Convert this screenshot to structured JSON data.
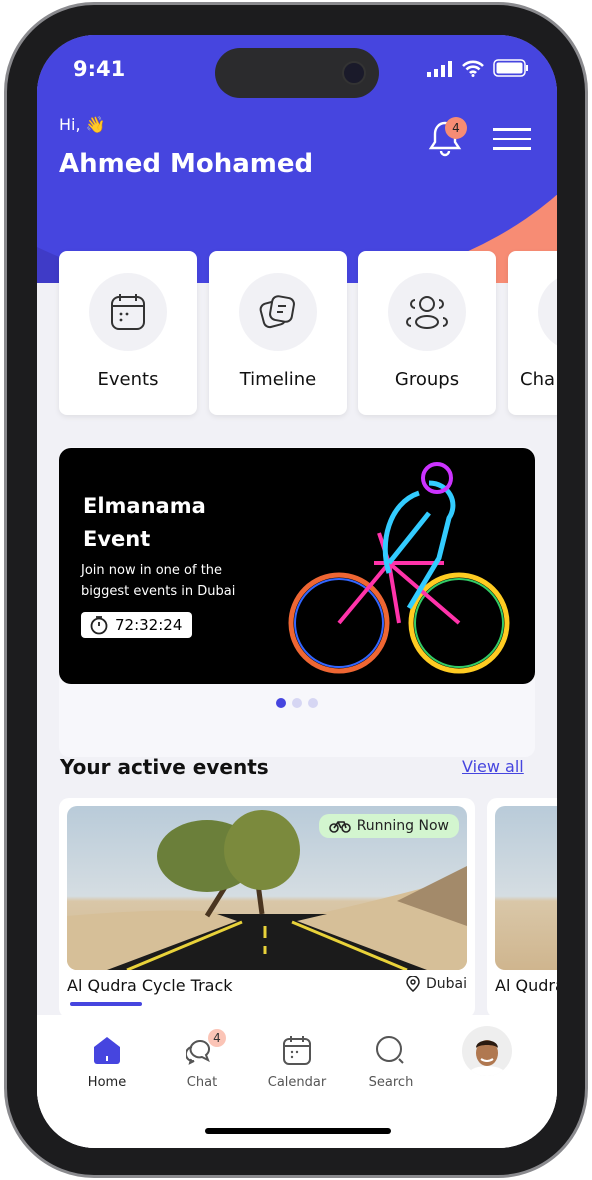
{
  "status_bar": {
    "time": "9:41"
  },
  "header": {
    "greeting": "Hi,",
    "user_name": "Ahmed Mohamed",
    "notification_count": "4"
  },
  "quick_actions": [
    {
      "label": "Events",
      "icon": "calendar-icon"
    },
    {
      "label": "Timeline",
      "icon": "notes-icon"
    },
    {
      "label": "Groups",
      "icon": "groups-icon"
    },
    {
      "label": "Cha",
      "icon": "chat-icon"
    }
  ],
  "banner": {
    "title": "Elmanama Event",
    "subtitle": "Join now in one of the biggest events in Dubai",
    "timer": "72:32:24",
    "active_dot": 0,
    "dots": 3
  },
  "active_events": {
    "title": "Your active events",
    "view_all": "View all",
    "items": [
      {
        "name": "Al Qudra Cycle Track",
        "location": "Dubai",
        "status": "Running Now"
      },
      {
        "name": "Al Qudra"
      }
    ]
  },
  "tabbar": {
    "items": [
      {
        "label": "Home"
      },
      {
        "label": "Chat",
        "badge": "4"
      },
      {
        "label": "Calendar"
      },
      {
        "label": "Search"
      }
    ]
  },
  "colors": {
    "primary": "#4645df",
    "accent": "#f78c74",
    "badge_green": "#d3f5cf"
  }
}
